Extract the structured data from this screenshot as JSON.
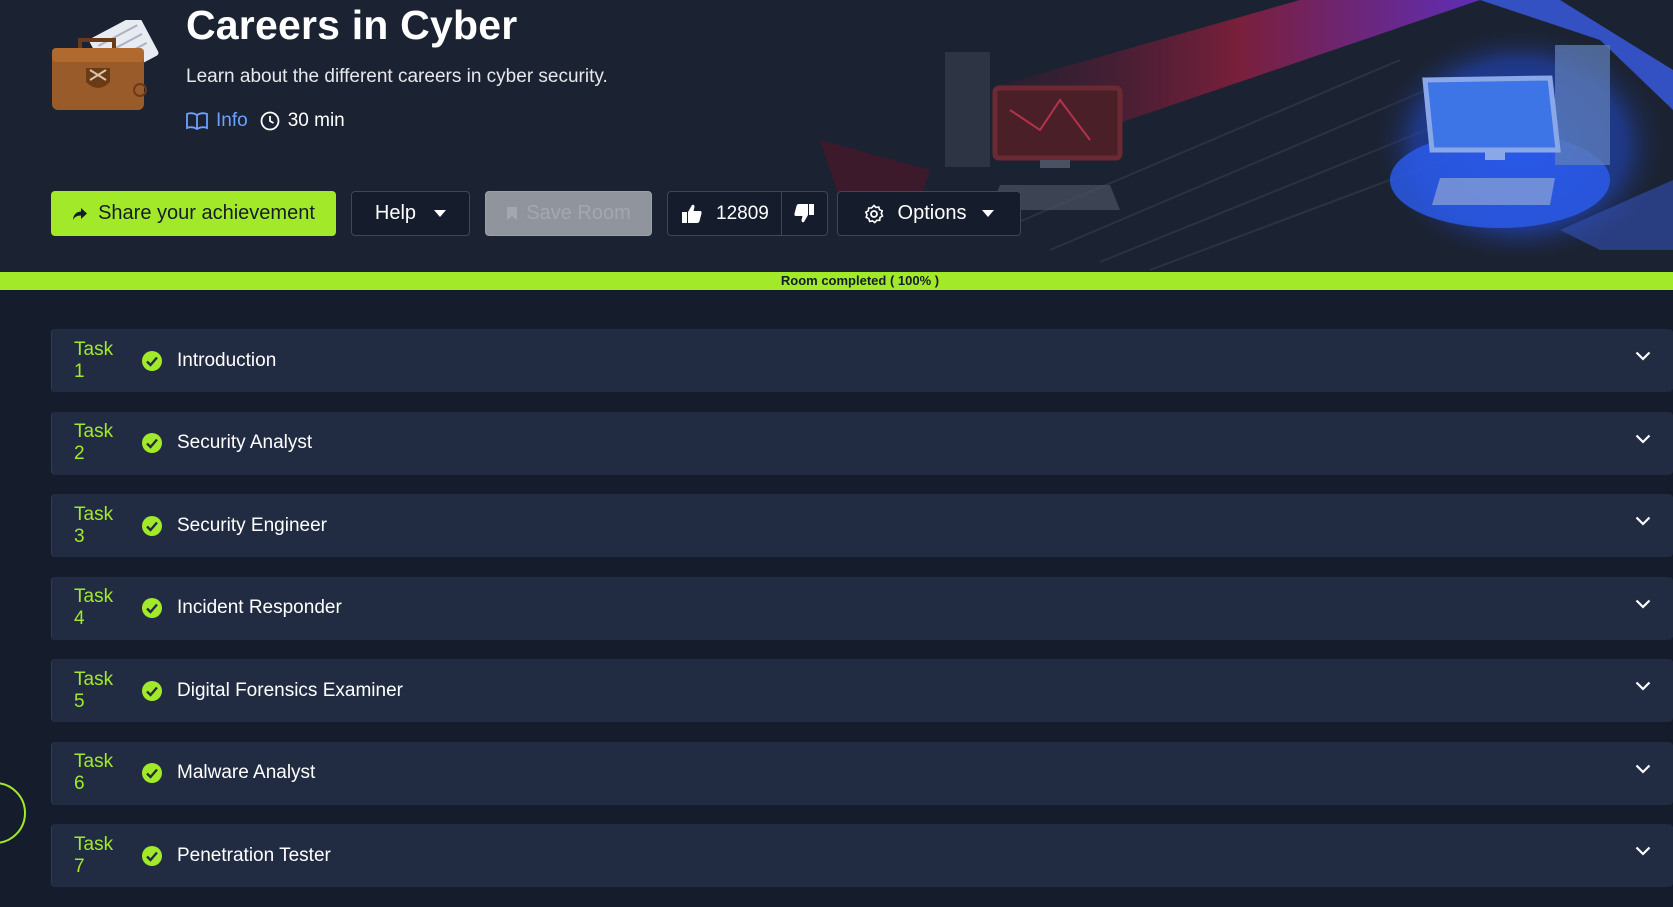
{
  "room": {
    "title": "Careers in Cyber",
    "description": "Learn about the different careers in cyber security.",
    "info_label": "Info",
    "duration": "30 min"
  },
  "actions": {
    "share_label": "Share your achievement",
    "help_label": "Help",
    "save_label": "Save Room",
    "upvotes": "12809",
    "options_label": "Options"
  },
  "progress": {
    "label": "Room completed ( 100% )",
    "percent": 100
  },
  "tasks": [
    {
      "number": "Task 1",
      "title": "Introduction",
      "completed": true
    },
    {
      "number": "Task 2",
      "title": "Security Analyst",
      "completed": true
    },
    {
      "number": "Task 3",
      "title": "Security Engineer",
      "completed": true
    },
    {
      "number": "Task 4",
      "title": "Incident Responder",
      "completed": true
    },
    {
      "number": "Task 5",
      "title": "Digital Forensics Examiner",
      "completed": true
    },
    {
      "number": "Task 6",
      "title": "Malware Analyst",
      "completed": true
    },
    {
      "number": "Task 7",
      "title": "Penetration Tester",
      "completed": true
    }
  ],
  "colors": {
    "accent": "#a2ea29",
    "background": "#151c2b",
    "task_card": "#212c42",
    "info_link": "#6ea0ff"
  }
}
